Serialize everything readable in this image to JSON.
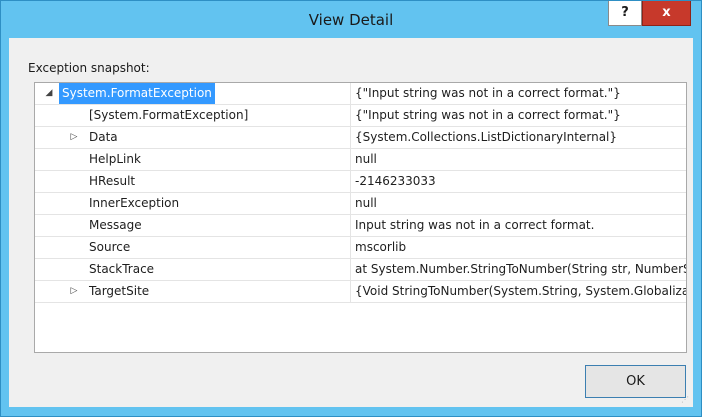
{
  "window": {
    "title": "View Detail",
    "help_label": "?",
    "close_label": "x"
  },
  "dialog": {
    "label": "Exception snapshot:",
    "ok_label": "OK"
  },
  "rows": [
    {
      "expander": "◢",
      "name": "System.FormatException",
      "value": "{\"Input string was not in a correct format.\"}",
      "level": 0,
      "selected": true
    },
    {
      "expander": "",
      "name": "[System.FormatException]",
      "value": "{\"Input string was not in a correct format.\"}",
      "level": 1,
      "selected": false
    },
    {
      "expander": "▷",
      "name": "Data",
      "value": "{System.Collections.ListDictionaryInternal}",
      "level": 1,
      "selected": false
    },
    {
      "expander": "",
      "name": "HelpLink",
      "value": "null",
      "level": 1,
      "selected": false
    },
    {
      "expander": "",
      "name": "HResult",
      "value": "-2146233033",
      "level": 1,
      "selected": false
    },
    {
      "expander": "",
      "name": "InnerException",
      "value": "null",
      "level": 1,
      "selected": false
    },
    {
      "expander": "",
      "name": "Message",
      "value": "Input string was not in a correct format.",
      "level": 1,
      "selected": false
    },
    {
      "expander": "",
      "name": "Source",
      "value": "mscorlib",
      "level": 1,
      "selected": false
    },
    {
      "expander": "",
      "name": "StackTrace",
      "value": "   at System.Number.StringToNumber(String str, NumberStyles options, NumberBuffer& number, NumberFormatInfo info, Boolean parseDecimal)",
      "level": 1,
      "selected": false
    },
    {
      "expander": "▷",
      "name": "TargetSite",
      "value": "{Void StringToNumber(System.String, System.Globalization.NumberStyles, NumberBuffer ByRef, System.Globalization.NumberFormatInfo, Boolean)}",
      "level": 1,
      "selected": false
    }
  ]
}
